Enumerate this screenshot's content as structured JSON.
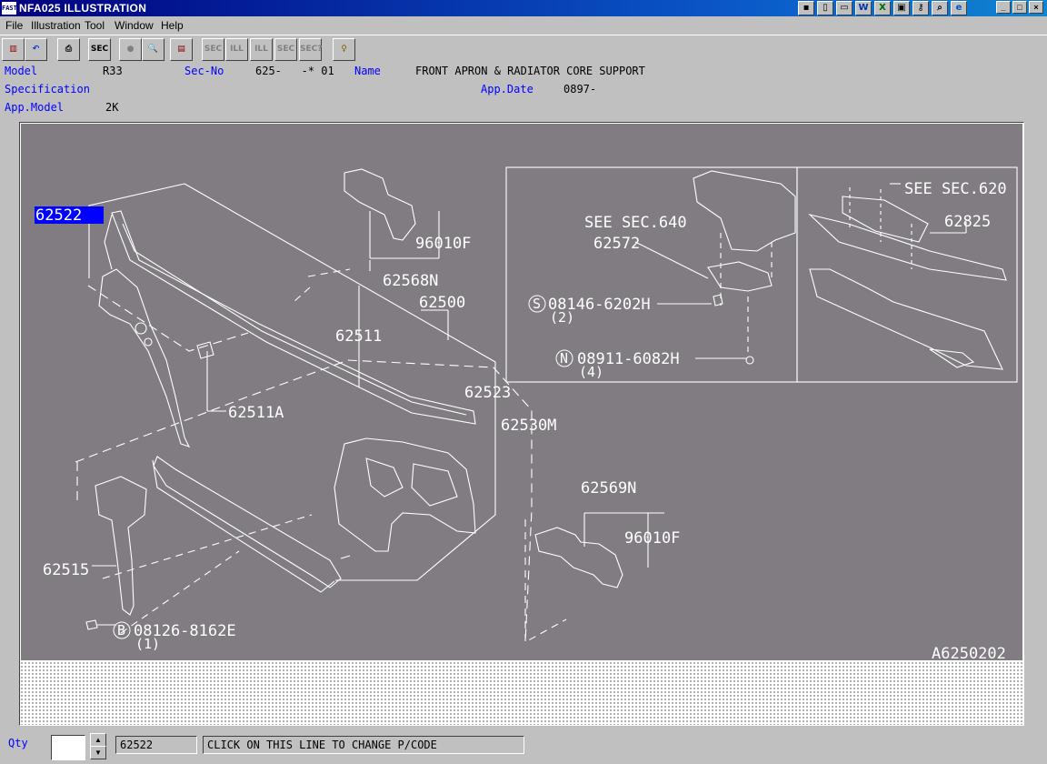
{
  "window": {
    "icon_text": "FAST",
    "title": "NFA025 ILLUSTRATION",
    "controls": {
      "minimize": "_",
      "maximize": "□",
      "close": "×"
    },
    "tray_icons": [
      "note-icon",
      "page-icon",
      "folder-icon",
      "word-icon",
      "excel-icon",
      "monitor-icon",
      "key-icon",
      "magnifier-icon",
      "ie-icon"
    ]
  },
  "menu": [
    "File",
    "Illustration",
    "Tool",
    "Window",
    "Help"
  ],
  "toolbar": {
    "buttons": [
      {
        "name": "parts-book-button",
        "glyph": "▥"
      },
      {
        "name": "undo-button",
        "glyph": "↶"
      },
      {
        "name": "print-button",
        "glyph": "⎙"
      },
      {
        "name": "sec-button",
        "glyph": "SEC"
      },
      {
        "name": "record-button",
        "glyph": "●"
      },
      {
        "name": "zoom-button",
        "glyph": "🔍"
      },
      {
        "name": "catalog-button",
        "glyph": "▤"
      },
      {
        "name": "sec-back-button",
        "glyph": "SEC"
      },
      {
        "name": "ill-prev-button",
        "glyph": "ILL"
      },
      {
        "name": "ill-next-button",
        "glyph": "ILL"
      },
      {
        "name": "sec-next-button",
        "glyph": "SEC"
      },
      {
        "name": "sec-query-button",
        "glyph": "SEC?"
      },
      {
        "name": "hint-button",
        "glyph": "♀"
      }
    ]
  },
  "info": {
    "model_label": "Model",
    "model_value": "R33",
    "secno_label": "Sec-No",
    "secno_value": "625-   -* 01",
    "name_label": "Name",
    "name_value": "FRONT APRON & RADIATOR CORE SUPPORT",
    "spec_label": "Specification",
    "appdate_label": "App.Date",
    "appdate_value": "0897-",
    "appmodel_label": "App.Model",
    "appmodel_value": "2K"
  },
  "illustration": {
    "selected_part": "62522",
    "drawing_code": "A6250202",
    "parts": [
      {
        "id": "96010F-top",
        "label": "96010F"
      },
      {
        "id": "62568N",
        "label": "62568N"
      },
      {
        "id": "62500",
        "label": "62500"
      },
      {
        "id": "62511",
        "label": "62511"
      },
      {
        "id": "62511A",
        "label": "62511A"
      },
      {
        "id": "62523",
        "label": "62523"
      },
      {
        "id": "62530M",
        "label": "62530M"
      },
      {
        "id": "62569N",
        "label": "62569N"
      },
      {
        "id": "96010F-bottom",
        "label": "96010F"
      },
      {
        "id": "62515",
        "label": "62515"
      },
      {
        "id": "62572",
        "label": "62572"
      },
      {
        "id": "62825",
        "label": "62825"
      }
    ],
    "fasteners": [
      {
        "id": "bolt-s",
        "symbol": "S",
        "code": "08146-6202H",
        "qty": "(2)"
      },
      {
        "id": "nut-n",
        "symbol": "N",
        "code": "08911-6082H",
        "qty": "(4)"
      },
      {
        "id": "bolt-b",
        "symbol": "B",
        "code": "08126-8162E",
        "qty": "(1)"
      }
    ],
    "references": {
      "sec640": "SEE SEC.640",
      "sec620": "SEE SEC.620"
    }
  },
  "status": {
    "qty_label": "Qty",
    "qty_value": "",
    "part_code": "62522",
    "message": "CLICK ON THIS LINE TO CHANGE P/CODE"
  }
}
